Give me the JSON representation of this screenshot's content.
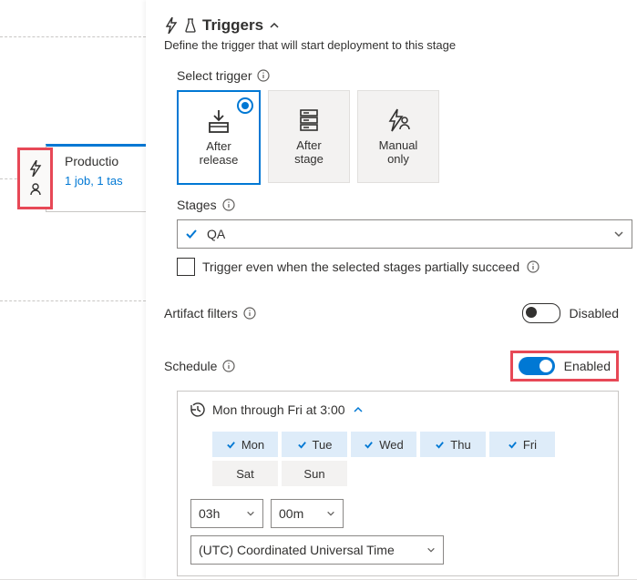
{
  "left": {
    "stage_name": "Productio",
    "stage_sub": "1 job, 1 tas"
  },
  "header": {
    "title": "Triggers",
    "subtitle": "Define the trigger that will start deployment to this stage"
  },
  "select_trigger": {
    "label": "Select trigger",
    "options": {
      "after_release": "After\nrelease",
      "after_stage": "After\nstage",
      "manual_only": "Manual\nonly"
    }
  },
  "stages": {
    "label": "Stages",
    "selected": "QA",
    "partial_label": "Trigger even when the selected stages partially succeed"
  },
  "artifact": {
    "label": "Artifact filters",
    "state": "Disabled"
  },
  "schedule": {
    "label": "Schedule",
    "state": "Enabled",
    "summary": "Mon through Fri at 3:00",
    "days": {
      "mon": "Mon",
      "tue": "Tue",
      "wed": "Wed",
      "thu": "Thu",
      "fri": "Fri",
      "sat": "Sat",
      "sun": "Sun"
    },
    "hour": "03h",
    "minute": "00m",
    "tz": "(UTC) Coordinated Universal Time"
  }
}
